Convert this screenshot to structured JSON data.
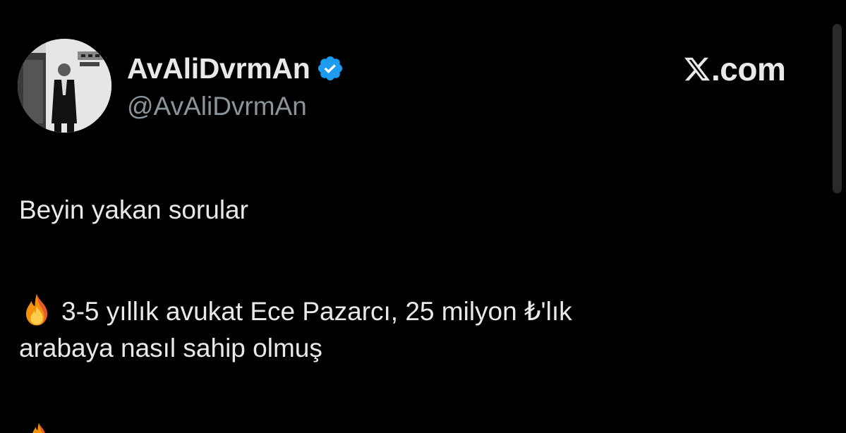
{
  "window": {
    "background": "#000000"
  },
  "header": {
    "avatar_icon": "profile-photo-man-in-suit",
    "display_name": "AvAliDvrmAn",
    "verified_icon": "verified-badge-icon",
    "verified_color": "#1d9bf0",
    "handle": "@AvAliDvrmAn"
  },
  "brand": {
    "icon": "x-logo-icon",
    "label": ".com"
  },
  "tweet": {
    "line1": "Beyin yakan sorular",
    "line2_icon": "fire-emoji",
    "line2": "3-5 yıllık avukat Ece Pazarcı,  25 milyon ₺'lık",
    "line3": "arabaya nasıl sahip olmuş",
    "next_line_icon": "fire-emoji"
  },
  "colors": {
    "text_primary": "#e7e9ea",
    "text_secondary": "#8b949a",
    "accent": "#1d9bf0"
  }
}
